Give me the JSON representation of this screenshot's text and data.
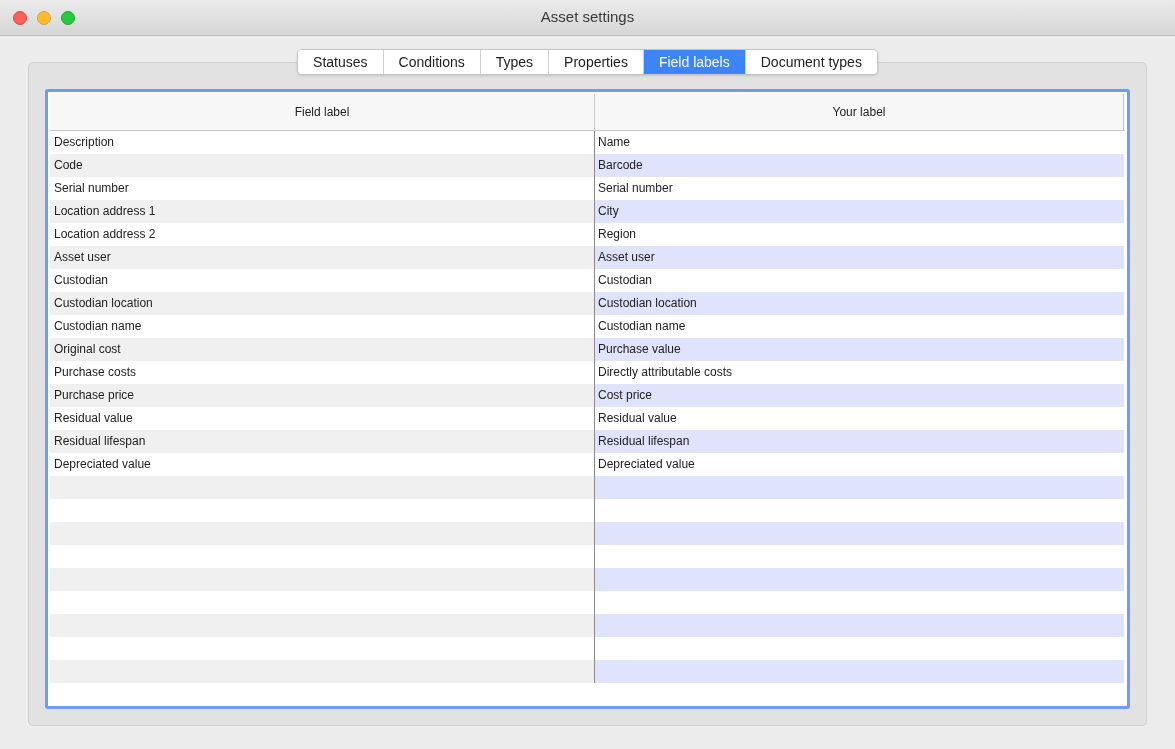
{
  "window": {
    "title": "Asset settings"
  },
  "tabs": [
    {
      "label": "Statuses",
      "selected": false
    },
    {
      "label": "Conditions",
      "selected": false
    },
    {
      "label": "Types",
      "selected": false
    },
    {
      "label": "Properties",
      "selected": false
    },
    {
      "label": "Field labels",
      "selected": true
    },
    {
      "label": "Document types",
      "selected": false
    }
  ],
  "table": {
    "columns": [
      "Field label",
      "Your label"
    ],
    "rows": [
      [
        "Description",
        "Name"
      ],
      [
        "Code",
        "Barcode"
      ],
      [
        "Serial number",
        "Serial number"
      ],
      [
        "Location address 1",
        "City"
      ],
      [
        "Location address 2",
        "Region"
      ],
      [
        "Asset user",
        "Asset user"
      ],
      [
        "Custodian",
        "Custodian"
      ],
      [
        "Custodian location",
        "Custodian location"
      ],
      [
        "Custodian name",
        "Custodian name"
      ],
      [
        "Original cost",
        "Purchase value"
      ],
      [
        "Purchase costs",
        "Directly attributable costs"
      ],
      [
        "Purchase price",
        "Cost price"
      ],
      [
        "Residual value",
        "Residual value"
      ],
      [
        "Residual lifespan",
        "Residual lifespan"
      ],
      [
        "Depreciated value",
        "Depreciated value"
      ]
    ]
  }
}
